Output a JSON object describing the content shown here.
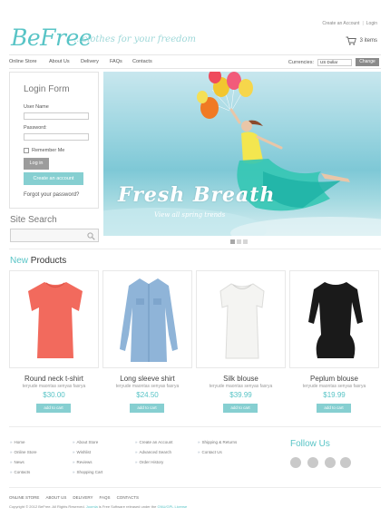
{
  "header": {
    "logo": "BeFree",
    "tagline": "...clothes for your freedom",
    "top_links": [
      "Create an Account",
      "Login"
    ],
    "cart_label": "3 items"
  },
  "nav": {
    "items": [
      "Online Store",
      "About Us",
      "Delivery",
      "FAQs",
      "Contacts"
    ],
    "currencies_label": "Currencies:",
    "currency_selected": "US Dollar",
    "change_label": "Change"
  },
  "login": {
    "title": "Login Form",
    "user_label": "User Name",
    "password_label": "Password:",
    "remember_label": "Remember Me",
    "login_button": "Log in",
    "create_button": "Create an account",
    "forgot": "Forgot your password?"
  },
  "search": {
    "title": "Site Search",
    "value": ""
  },
  "slider": {
    "title": "Fresh Breath",
    "subtitle": "View all spring trends",
    "pages": 3,
    "active_page": 1
  },
  "products": {
    "title_accent": "New",
    "title_rest": " Products",
    "items": [
      {
        "name": "Round neck t-shirt",
        "desc": "teryude maontas senyas fasrya",
        "price": "$30.00",
        "button": "add to cart",
        "color": "#f26a5d"
      },
      {
        "name": "Long sleeve shirt",
        "desc": "teryude maontas senyas fasrya",
        "price": "$24.50",
        "button": "add to cart",
        "color": "#8fb4d8"
      },
      {
        "name": "Silk blouse",
        "desc": "teryude maontas senyas fasrya",
        "price": "$39.99",
        "button": "add to cart",
        "color": "#f4f4f2"
      },
      {
        "name": "Peplum blouse",
        "desc": "teryude maontas senyas fasrya",
        "price": "$19.99",
        "button": "add to cart",
        "color": "#1a1a1a"
      }
    ]
  },
  "footer": {
    "col1": [
      "Home",
      "Online Store",
      "News",
      "Contacts"
    ],
    "col2": [
      "About Store",
      "Wishlist",
      "Reviews",
      "Shopping Cart"
    ],
    "col3": [
      "Create an Account",
      "Advanced Search",
      "Order History"
    ],
    "col4": [
      "Shipping & Returns",
      "Contact Us"
    ],
    "follow_title": "Follow Us",
    "social_icons": [
      "facebook-icon",
      "twitter-icon",
      "google-icon",
      "share-icon"
    ],
    "bottom_nav": [
      "ONLINE STORE",
      "ABOUT US",
      "DELIVERY",
      "FAQS",
      "CONTACTS"
    ],
    "copyright": "Copyright © 2012 BeFree. All Rights Reserved.",
    "copyright_link": "Joomla",
    "copyright_tail": "is Free Software released under the",
    "license_link": "GNU/GPL License"
  },
  "colors": {
    "accent": "#58c4c6",
    "button": "#86cfd1"
  }
}
